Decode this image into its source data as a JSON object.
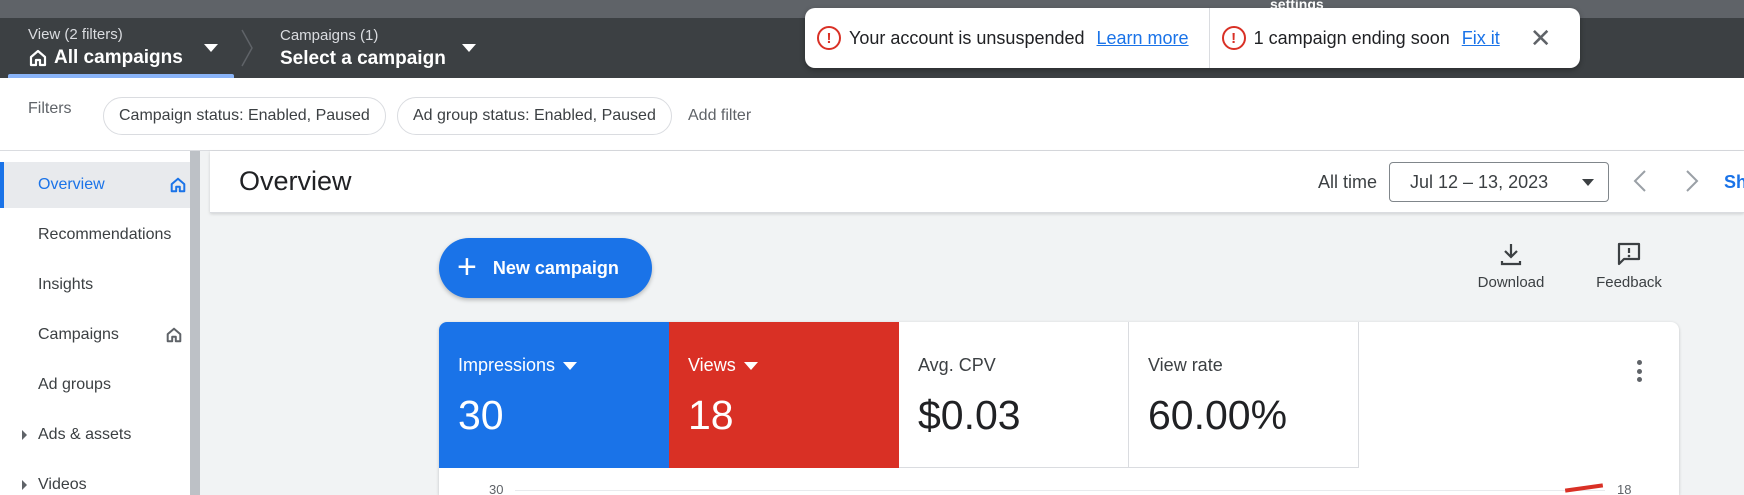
{
  "top_strip": {
    "cut_text": "settings"
  },
  "header": {
    "view": {
      "small": "View (2 filters)",
      "big": "All campaigns"
    },
    "campaigns": {
      "small": "Campaigns (1)",
      "big": "Select a campaign"
    }
  },
  "notifications": {
    "account": {
      "text": "Your account is unsuspended",
      "link": "Learn more"
    },
    "campaign": {
      "text": "1 campaign ending soon",
      "link": "Fix it"
    }
  },
  "filters": {
    "label": "Filters",
    "chips": [
      "Campaign status: Enabled, Paused",
      "Ad group status: Enabled, Paused"
    ],
    "add": "Add filter"
  },
  "sidebar": {
    "items": [
      {
        "label": "Overview"
      },
      {
        "label": "Recommendations"
      },
      {
        "label": "Insights"
      },
      {
        "label": "Campaigns"
      },
      {
        "label": "Ad groups"
      },
      {
        "label": "Ads & assets"
      },
      {
        "label": "Videos"
      }
    ]
  },
  "main": {
    "title": "Overview",
    "range_label": "All time",
    "date_range": "Jul 12 – 13, 2023",
    "cut_link": "Sh",
    "new_campaign": "New campaign",
    "download": "Download",
    "feedback": "Feedback",
    "metrics": [
      {
        "name": "Impressions",
        "value": "30"
      },
      {
        "name": "Views",
        "value": "18"
      },
      {
        "name": "Avg. CPV",
        "value": "$0.03"
      },
      {
        "name": "View rate",
        "value": "60.00%"
      }
    ],
    "chart_axis": {
      "left_top": "30",
      "right_top": "18"
    }
  },
  "colors": {
    "accent": "#1a73e8",
    "views": "#d93025",
    "header": "#3c4043"
  }
}
